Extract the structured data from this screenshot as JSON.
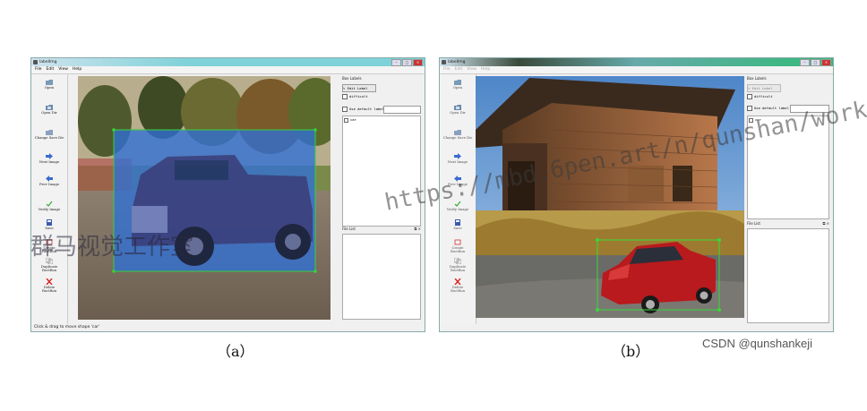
{
  "window_a": {
    "title": "labelImg",
    "menu": [
      "File",
      "Edit",
      "View",
      "Help"
    ],
    "tools": [
      {
        "label": "Open",
        "icon": "open-icon"
      },
      {
        "label": "Open Dir",
        "icon": "open-dir-icon"
      },
      {
        "label": "Change Save Dir",
        "icon": "change-save-dir-icon"
      },
      {
        "label": "Next Image",
        "icon": "next-image-icon"
      },
      {
        "label": "Prev Image",
        "icon": "prev-image-icon"
      },
      {
        "label": "Verify Image",
        "icon": "verify-image-icon"
      },
      {
        "label": "Save",
        "icon": "save-icon"
      },
      {
        "label": "Create\nRectBox",
        "icon": "create-rectbox-icon"
      },
      {
        "label": "Duplicate\nRectBox",
        "icon": "duplicate-rectbox-icon"
      },
      {
        "label": "Delete\nRectBox",
        "icon": "delete-rectbox-icon"
      }
    ],
    "box_labels_title": "Box Labels",
    "edit_label_button": "Edit Label",
    "difficult_label": "difficult",
    "use_default_label": "Use default label",
    "labels": [
      "car"
    ],
    "file_list_title": "File List",
    "status": "Click & drag to move shape 'car'"
  },
  "window_b": {
    "title": "labelImg",
    "menu": [
      "File",
      "Edit",
      "View",
      "Help"
    ],
    "tools": [
      {
        "label": "Open",
        "icon": "open-icon"
      },
      {
        "label": "Open Dir",
        "icon": "open-dir-icon"
      },
      {
        "label": "Change Save Dir",
        "icon": "change-save-dir-icon"
      },
      {
        "label": "Next Image",
        "icon": "next-image-icon"
      },
      {
        "label": "Prev Image",
        "icon": "prev-image-icon"
      },
      {
        "label": "Verify Image",
        "icon": "verify-image-icon"
      },
      {
        "label": "Save",
        "icon": "save-icon"
      },
      {
        "label": "Create\nRectBox",
        "icon": "create-rectbox-icon"
      },
      {
        "label": "Duplicate\nRectBox",
        "icon": "duplicate-rectbox-icon"
      },
      {
        "label": "Delete\nRectBox",
        "icon": "delete-rectbox-icon"
      }
    ],
    "box_labels_title": "Box Labels",
    "edit_label_button": "Edit Label",
    "difficult_label": "difficult",
    "use_default_label": "Use default label",
    "labels": [
      "car"
    ],
    "file_list_title": "File List"
  },
  "captions": {
    "a": "（a）",
    "b": "（b）"
  },
  "credit": "CSDN @qunshankeji",
  "watermarks": {
    "wm1": "https://mbd.6pen.art/n/qunshan/work",
    "wm3": "群马视觉工作室"
  },
  "colors": {
    "selection_fill": "#2f6fd6",
    "selection_border": "#3ad13a",
    "bbox_green": "#38d838"
  }
}
